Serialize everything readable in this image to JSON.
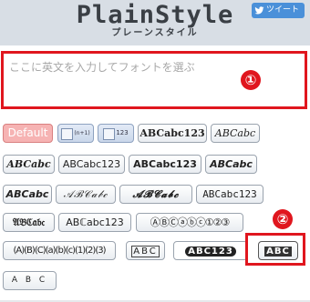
{
  "header": {
    "title": "PlainStyle",
    "subtitle": "プレーンスタイル",
    "tweet_label": "ツイート"
  },
  "input": {
    "placeholder": "ここに英文を入力してフォントを選ぶ"
  },
  "markers": {
    "one": "①",
    "two": "②"
  },
  "styles": {
    "default": "Default",
    "superscript": "(n+1)",
    "subscript": "123",
    "serif_bold": "ABCabc123",
    "serif_italic": "ABCabc",
    "serif_bold_italic": "ABCabc",
    "sans": "ABCabc123",
    "sans_bold": "ABCabc123",
    "sans_bold_italic": "ABCabc",
    "script": "𝒜ℬ𝒞𝒶𝒷𝒸",
    "script_bold": "𝓐𝓑𝓒𝓪𝓫𝓬",
    "monospace": "ABCabc123",
    "fraktur": "𝔄𝔅ℭ𝔞𝔟𝔠",
    "double_struck": "ABℂabc123",
    "circled": "ⒶⒷⒸⓐⓑⓒ①②③",
    "parenthesized": "⒜⒝⒞⒜⒝⒞⑴⑵⑶",
    "parenthesized_display": "(A)(B)(C)(a)(b)(c)(1)(2)(3)",
    "squared": "🄰🄱🄲",
    "squared_display": "ABC",
    "negative_circled": "🅐🅑🅒①②③",
    "negative_circled_display": "ABC123",
    "negative_squared": "🅰🅱🅲",
    "negative_squared_display": "ABC",
    "fullwidth_spaced": "A B C"
  }
}
